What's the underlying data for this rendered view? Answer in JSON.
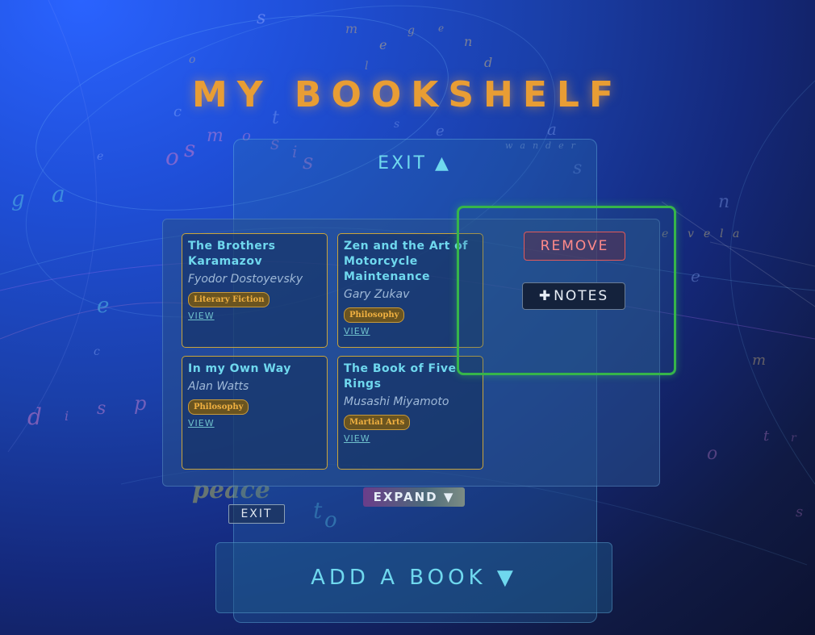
{
  "header": {
    "title": "MY BOOKSHELF"
  },
  "panel": {
    "exit_top_label": "EXIT ▲"
  },
  "books": [
    {
      "title": "The Brothers Karamazov",
      "author": "Fyodor Dostoyevsky",
      "genre": "Literary Fiction",
      "view_label": "VIEW"
    },
    {
      "title": "Zen and the Art of Motorcycle Maintenance",
      "author": "Gary Zukav",
      "genre": "Philosophy",
      "view_label": "VIEW"
    },
    {
      "title": "In my Own Way",
      "author": "Alan Watts",
      "genre": "Philosophy",
      "view_label": "VIEW"
    },
    {
      "title": "The Book of Five Rings",
      "author": "Musashi Miyamoto",
      "genre": "Martial Arts",
      "view_label": "VIEW"
    }
  ],
  "actions": {
    "remove_label": "REMOVE",
    "notes_label": "NOTES",
    "notes_icon": "plus-icon"
  },
  "expand_label": "EXPAND ▼",
  "exit_bottom_label": "EXIT",
  "add_book_label": "ADD A BOOK ▼",
  "background": {
    "floating_letters": [
      "s",
      "m",
      "e",
      "g",
      "e",
      "n",
      "o",
      "l",
      "d",
      "o",
      "s",
      "m",
      "o",
      "s",
      "i",
      "s",
      "c",
      "t",
      "s",
      "e",
      "g",
      "a",
      "e",
      "d",
      "i",
      "s",
      "p",
      "e",
      "c",
      "o",
      "t",
      "a",
      "s",
      "n",
      "e",
      "e",
      "v",
      "e",
      "l",
      "a",
      "m",
      "t",
      "r",
      "o",
      "s"
    ],
    "words": [
      "peace",
      "wander"
    ]
  },
  "colors": {
    "accent_title": "#e89d34",
    "accent_cyan": "#6fd8ee",
    "highlight_green": "#36b54a",
    "remove_red": "#e05a5a"
  }
}
